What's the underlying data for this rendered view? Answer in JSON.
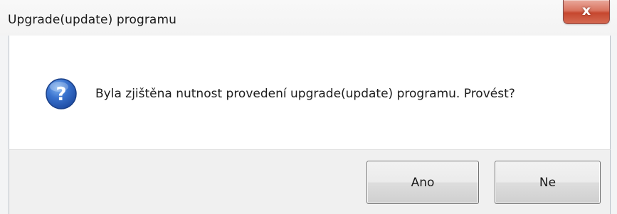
{
  "window": {
    "title": "Upgrade(update) programu",
    "close_glyph": "x"
  },
  "dialog": {
    "icon": "question-icon",
    "message": "Byla zjištěna nutnost provedení upgrade(update) programu. Provést?"
  },
  "buttons": {
    "yes_label": "Ano",
    "no_label": "Ne"
  },
  "colors": {
    "close_button": "#c6472f",
    "icon_blue": "#2b5fb4",
    "footer_bg": "#f0f0f0"
  }
}
